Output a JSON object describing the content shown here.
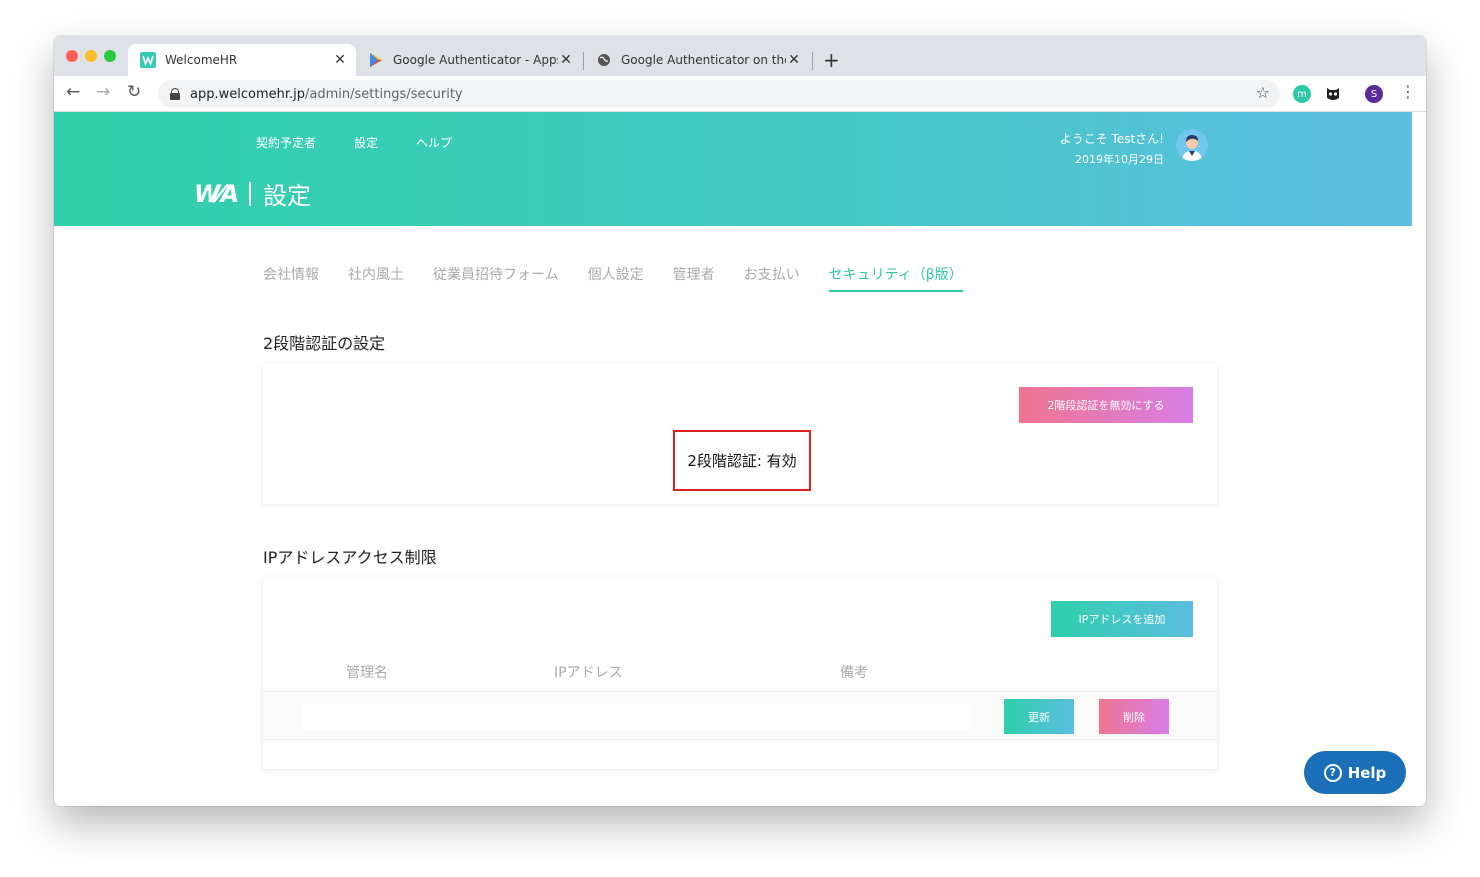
{
  "browser": {
    "tabs": [
      {
        "title": "WelcomeHR",
        "favicon": "welcomehr-icon"
      },
      {
        "title": "Google Authenticator - Apps on",
        "favicon": "google-play-icon"
      },
      {
        "title": "Google Authenticator on the App",
        "favicon": "globe-icon"
      }
    ],
    "url_host": "app.welcomehr.jp",
    "url_path": "/admin/settings/security",
    "profile_initial": "S",
    "ext_initial": "m"
  },
  "header": {
    "nav": [
      "契約予定者",
      "設定",
      "ヘルプ"
    ],
    "logo_mark": "W⁄A",
    "page_title": "設定",
    "welcome": "ようこそ Testさん!",
    "date": "2019年10月29日"
  },
  "subtabs": [
    "会社情報",
    "社内風土",
    "従業員招待フォーム",
    "個人設定",
    "管理者",
    "お支払い",
    "セキュリティ（β版）"
  ],
  "two_factor": {
    "section_title": "2段階認証の設定",
    "disable_button": "2階段認証を無効にする",
    "status": "2段階認証: 有効"
  },
  "ip": {
    "section_title": "IPアドレスアクセス制限",
    "add_button": "IPアドレスを追加",
    "columns": [
      "管理名",
      "IPアドレス",
      "備考"
    ],
    "update_button": "更新",
    "delete_button": "削除"
  },
  "help": {
    "label": "Help"
  },
  "colors": {
    "accent": "#2ec8a6",
    "pink": "#ef7490",
    "help": "#1a6fb8"
  }
}
